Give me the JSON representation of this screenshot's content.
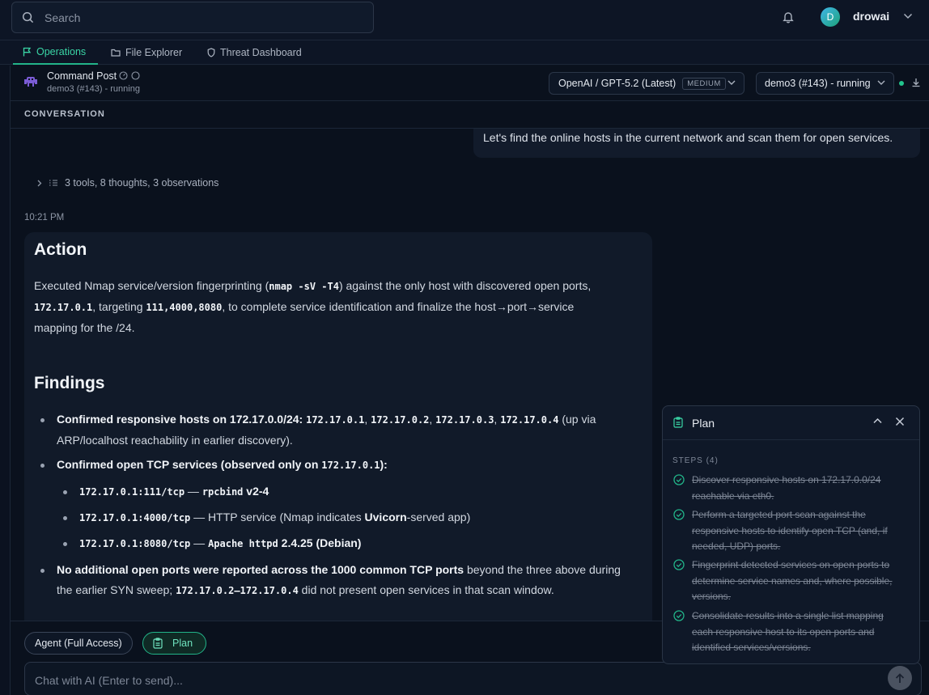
{
  "search": {
    "placeholder": "Search"
  },
  "user": {
    "initial": "D",
    "name": "drowai"
  },
  "tabs": [
    {
      "label": "Operations",
      "icon": "flag-icon",
      "active": true
    },
    {
      "label": "File Explorer",
      "icon": "folder-icon",
      "active": false
    },
    {
      "label": "Threat Dashboard",
      "icon": "shield-icon",
      "active": false
    }
  ],
  "header": {
    "title": "Command Post",
    "subtitle": "demo3 (#143) - running",
    "model": "OpenAI / GPT-5.2 (Latest)",
    "model_badge": "MEDIUM",
    "session": "demo3 (#143) - running"
  },
  "conversation": {
    "label": "CONVERSATION",
    "user_message": "Let's find the online hosts in the current network and scan them for open services.",
    "tools_summary": "3 tools, 8 thoughts, 3 observations",
    "timestamp": "10:21 PM",
    "action": {
      "heading": "Action",
      "p1": "Executed Nmap service/version fingerprinting (",
      "cmd": "nmap -sV -T4",
      "p2": ") against the only host with discovered open ports,",
      "host": "172.17.0.1",
      "p3": ", targeting ",
      "ports": "111,4000,8080",
      "p4": ", to complete service identification and finalize the host→port→service",
      "p5": "mapping for the /24."
    },
    "findings": {
      "heading": "Findings",
      "item1": {
        "bold": "Confirmed responsive hosts on 172.17.0.0/24: ",
        "h1": "172.17.0.1",
        "h2": "172.17.0.2",
        "h3": "172.17.0.3",
        "h4": "172.17.0.4",
        "comma": ",",
        "rest1": " (up via",
        "rest2": "ARP/localhost reachability in earlier discovery)."
      },
      "item2": {
        "bold1": "Confirmed open TCP services (observed only on ",
        "host": "172.17.0.1",
        "bold2": "):",
        "sub": [
          {
            "port": "172.17.0.1:111/tcp",
            "sep": " — ",
            "svc": "rpcbind",
            "ver": " v2-4"
          },
          {
            "port": "172.17.0.1:4000/tcp",
            "sep": " — HTTP service (Nmap indicates ",
            "svc": "Uvicorn",
            "ver": "-served app)"
          },
          {
            "port": "172.17.0.1:8080/tcp",
            "sep": " — ",
            "svc": "Apache httpd",
            "ver": " 2.4.25 (Debian)"
          }
        ]
      },
      "item3": {
        "bold": "No additional open ports were reported across the 1000 common TCP ports",
        "rest1": " beyond the three above during",
        "rest2": "the earlier SYN sweep; ",
        "range": "172.17.0.2–172.17.0.4",
        "rest3": " did not present open services in that scan window."
      }
    }
  },
  "composer": {
    "agent_chip": "Agent (Full Access)",
    "plan_chip": "Plan",
    "placeholder": "Chat with AI (Enter to send)..."
  },
  "plan": {
    "title": "Plan",
    "steps_label": "STEPS (4)",
    "steps": [
      "Discover responsive hosts on 172.17.0.0/24 reachable via eth0.",
      "Perform a targeted port scan against the responsive hosts to identify open TCP (and, if needed, UDP) ports.",
      "Fingerprint detected services on open ports to determine service names and, where possible, versions.",
      "Consolidate results into a single list mapping each responsive host to its open ports and identified services/versions."
    ]
  },
  "colors": {
    "accent": "#22b489",
    "background": "#0b1220",
    "status_running": "#22c58d"
  }
}
